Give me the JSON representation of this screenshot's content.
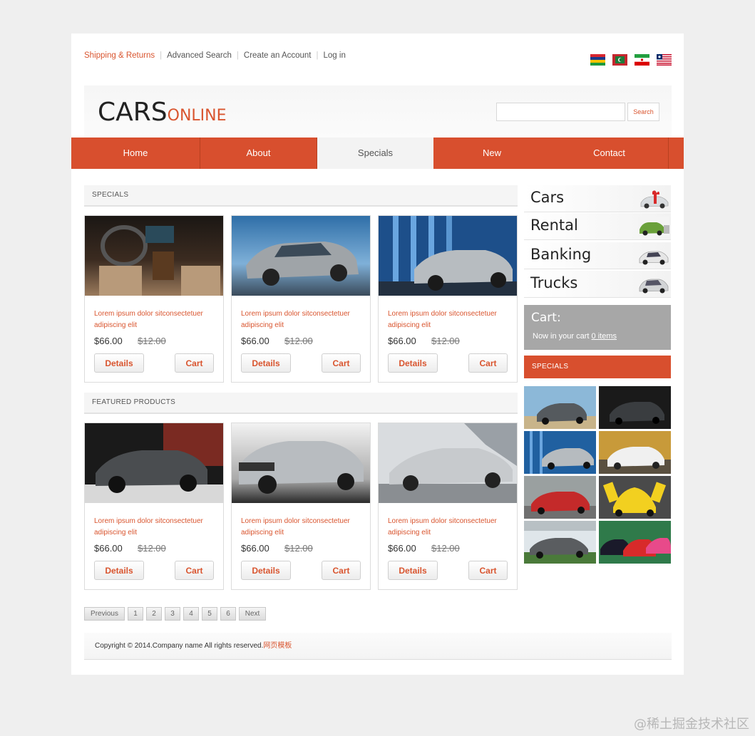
{
  "top_links": [
    "Shipping & Returns",
    "Advanced Search",
    "Create an Account",
    "Log in"
  ],
  "flags": [
    "flag-icon-1",
    "flag-icon-2",
    "flag-icon-3",
    "flag-icon-4"
  ],
  "logo": {
    "big": "CARS",
    "small": "ONLINE"
  },
  "search": {
    "value": "",
    "button": "Search"
  },
  "nav": [
    "Home",
    "About",
    "Specials",
    "New",
    "Contact"
  ],
  "nav_active": "Specials",
  "sections": {
    "specials": "SPECIALS",
    "featured": "FEATURED PRODUCTS"
  },
  "products": [
    {
      "desc": "Lorem ipsum dolor sitconsectetuer adipiscing elit",
      "price": "$66.00",
      "old_price": "$12.00",
      "details": "Details",
      "cart": "Cart"
    },
    {
      "desc": "Lorem ipsum dolor sitconsectetuer adipiscing elit",
      "price": "$66.00",
      "old_price": "$12.00",
      "details": "Details",
      "cart": "Cart"
    },
    {
      "desc": "Lorem ipsum dolor sitconsectetuer adipiscing elit",
      "price": "$66.00",
      "old_price": "$12.00",
      "details": "Details",
      "cart": "Cart"
    },
    {
      "desc": "Lorem ipsum dolor sitconsectetuer adipiscing elit",
      "price": "$66.00",
      "old_price": "$12.00",
      "details": "Details",
      "cart": "Cart"
    },
    {
      "desc": "Lorem ipsum dolor sitconsectetuer adipiscing elit",
      "price": "$66.00",
      "old_price": "$12.00",
      "details": "Details",
      "cart": "Cart"
    },
    {
      "desc": "Lorem ipsum dolor sitconsectetuer adipiscing elit",
      "price": "$66.00",
      "old_price": "$12.00",
      "details": "Details",
      "cart": "Cart"
    }
  ],
  "pager": {
    "prev": "Previous",
    "pages": [
      "1",
      "2",
      "3",
      "4",
      "5",
      "6"
    ],
    "next": "Next"
  },
  "footer": {
    "text": "Copyright © 2014.Company name All rights reserved.",
    "link": "网页模板"
  },
  "sidebar": {
    "categories": [
      "Cars",
      "Rental",
      "Banking",
      "Trucks"
    ],
    "cart_title": "Cart:",
    "cart_text": "Now in your cart ",
    "cart_items": " 0 items",
    "specials": "SPECIALS"
  },
  "watermark": "@稀土掘金技术社区",
  "colors": {
    "accent": "#d84f2e",
    "link": "#d9552f",
    "background": "#efefef"
  }
}
